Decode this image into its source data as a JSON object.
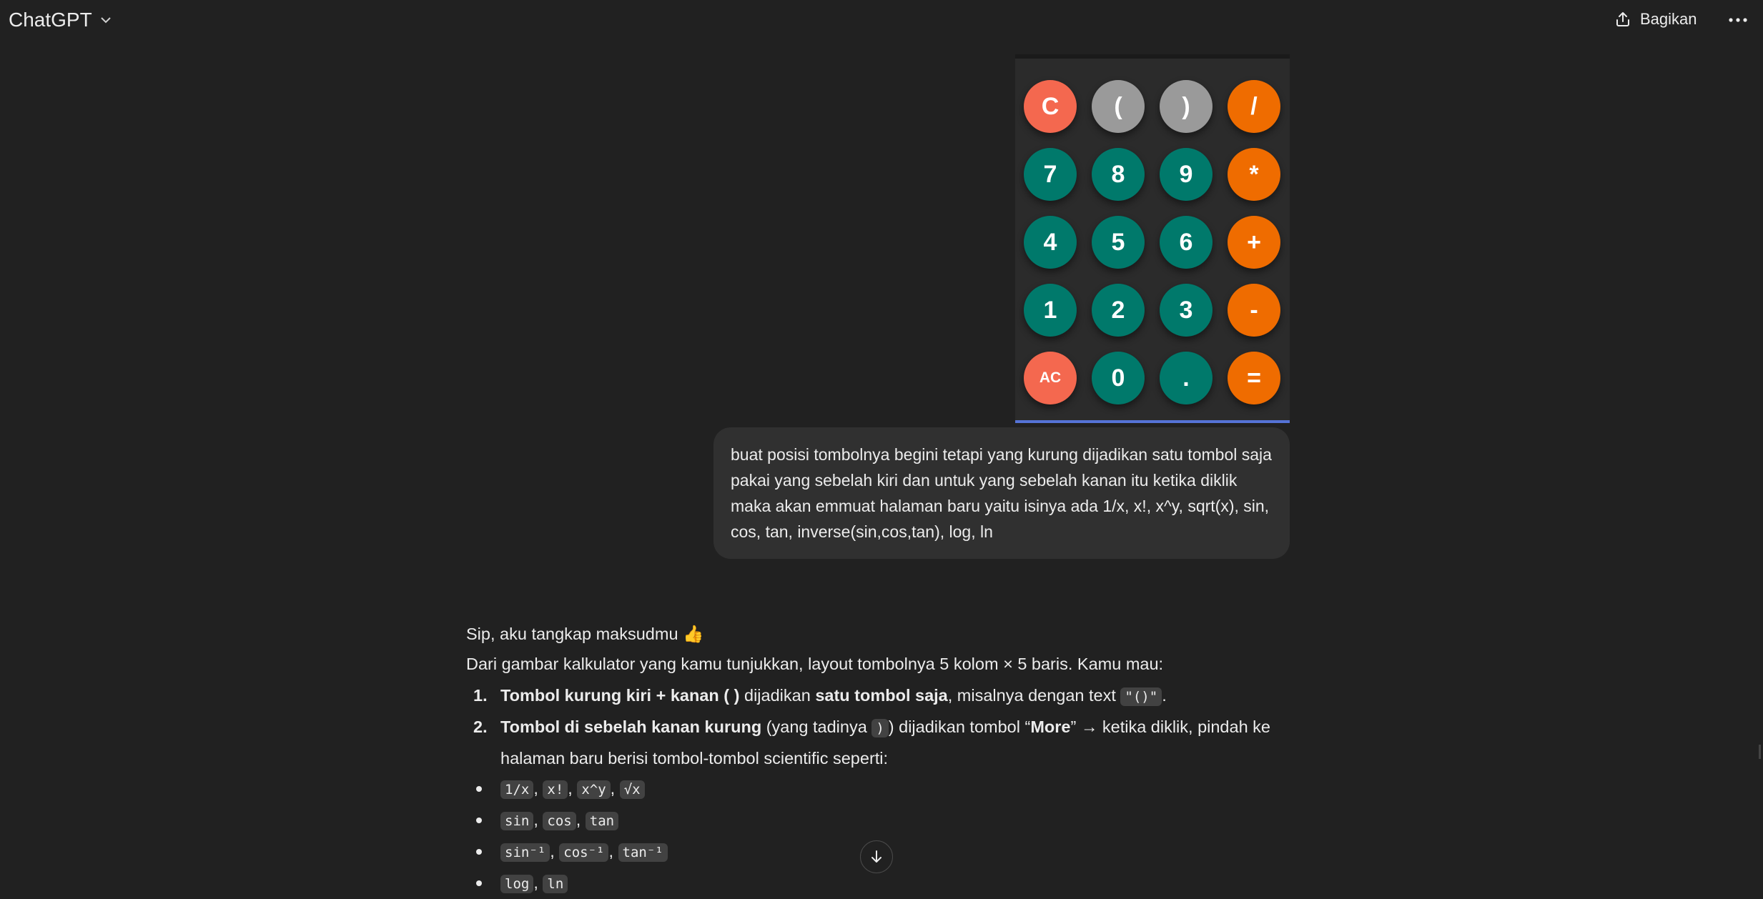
{
  "header": {
    "title": "ChatGPT",
    "share_label": "Bagikan",
    "icons": [
      "chevron-down-icon",
      "share-icon",
      "more-icon"
    ]
  },
  "calculator_image": {
    "keys": [
      {
        "label": "C",
        "color": "#f4684f"
      },
      {
        "label": "(",
        "color": "#9a9a9a"
      },
      {
        "label": ")",
        "color": "#9a9a9a"
      },
      {
        "label": "/",
        "color": "#ef6c00"
      },
      {
        "label": "7",
        "color": "#00796b"
      },
      {
        "label": "8",
        "color": "#00796b"
      },
      {
        "label": "9",
        "color": "#00796b"
      },
      {
        "label": "*",
        "color": "#ef6c00"
      },
      {
        "label": "4",
        "color": "#00796b"
      },
      {
        "label": "5",
        "color": "#00796b"
      },
      {
        "label": "6",
        "color": "#00796b"
      },
      {
        "label": "+",
        "color": "#ef6c00"
      },
      {
        "label": "1",
        "color": "#00796b"
      },
      {
        "label": "2",
        "color": "#00796b"
      },
      {
        "label": "3",
        "color": "#00796b"
      },
      {
        "label": "-",
        "color": "#ef6c00"
      },
      {
        "label": "AC",
        "color": "#f4684f"
      },
      {
        "label": "0",
        "color": "#00796b"
      },
      {
        "label": ".",
        "color": "#00796b"
      },
      {
        "label": "=",
        "color": "#ef6c00"
      }
    ]
  },
  "user_message": {
    "text": "buat posisi tombolnya begini tetapi yang kurung dijadikan satu tombol saja pakai yang sebelah kiri dan untuk yang sebelah kanan itu ketika diklik maka akan emmuat halaman baru yaitu isinya ada 1/x, x!, x^y, sqrt(x), sin, cos, tan, inverse(sin,cos,tan), log, ln"
  },
  "assistant": {
    "line1": "Sip, aku tangkap maksudmu 👍",
    "line2": "Dari gambar kalkulator yang kamu tunjukkan, layout tombolnya 5 kolom × 5 baris. Kamu mau:",
    "item1": {
      "num": "1.",
      "bold1": "Tombol kurung kiri + kanan ( )",
      "text1": " dijadikan ",
      "bold2": "satu tombol saja",
      "text2": ", misalnya dengan text ",
      "code": "\"()\"",
      "text3": "."
    },
    "item2": {
      "num": "2.",
      "bold1": "Tombol di sebelah kanan kurung",
      "text1": " (yang tadinya ",
      "code": ")",
      "text2": ") dijadikan tombol “",
      "bold2": "More",
      "text3": "” → ketika diklik, pindah ke halaman baru berisi tombol-tombol scientific seperti:"
    },
    "sub_items": [
      [
        "1/x",
        "x!",
        "x^y",
        "√x"
      ],
      [
        "sin",
        "cos",
        "tan"
      ],
      [
        "sin⁻¹",
        "cos⁻¹",
        "tan⁻¹"
      ],
      [
        "log",
        "ln"
      ]
    ]
  },
  "scroll_button": {
    "icon": "arrow-down-icon"
  }
}
